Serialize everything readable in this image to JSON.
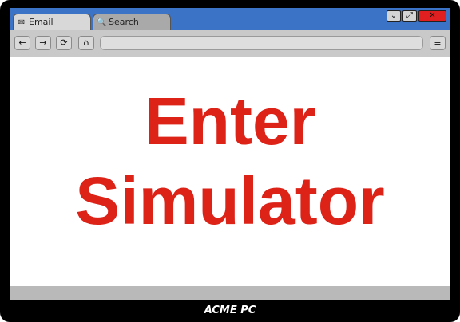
{
  "tabs": [
    {
      "icon": "envelope-icon",
      "glyph": "✉",
      "label": "Email"
    },
    {
      "icon": "search-icon",
      "glyph": "🔍",
      "label": "Search"
    }
  ],
  "window_controls": {
    "minimize_glyph": "⌄",
    "maximize_glyph": "⤢",
    "close_glyph": "✕"
  },
  "toolbar": {
    "back_glyph": "←",
    "forward_glyph": "→",
    "reload_glyph": "⟳",
    "home_glyph": "⌂",
    "menu_glyph": "≡",
    "address_value": ""
  },
  "main": {
    "headline_line1": "Enter",
    "headline_line2": "Simulator"
  },
  "footer": {
    "brand": "ACME PC"
  },
  "colors": {
    "bezel": "#000000",
    "titlebar": "#3b73c7",
    "headline": "#dd2218",
    "close_button": "#e02020"
  }
}
